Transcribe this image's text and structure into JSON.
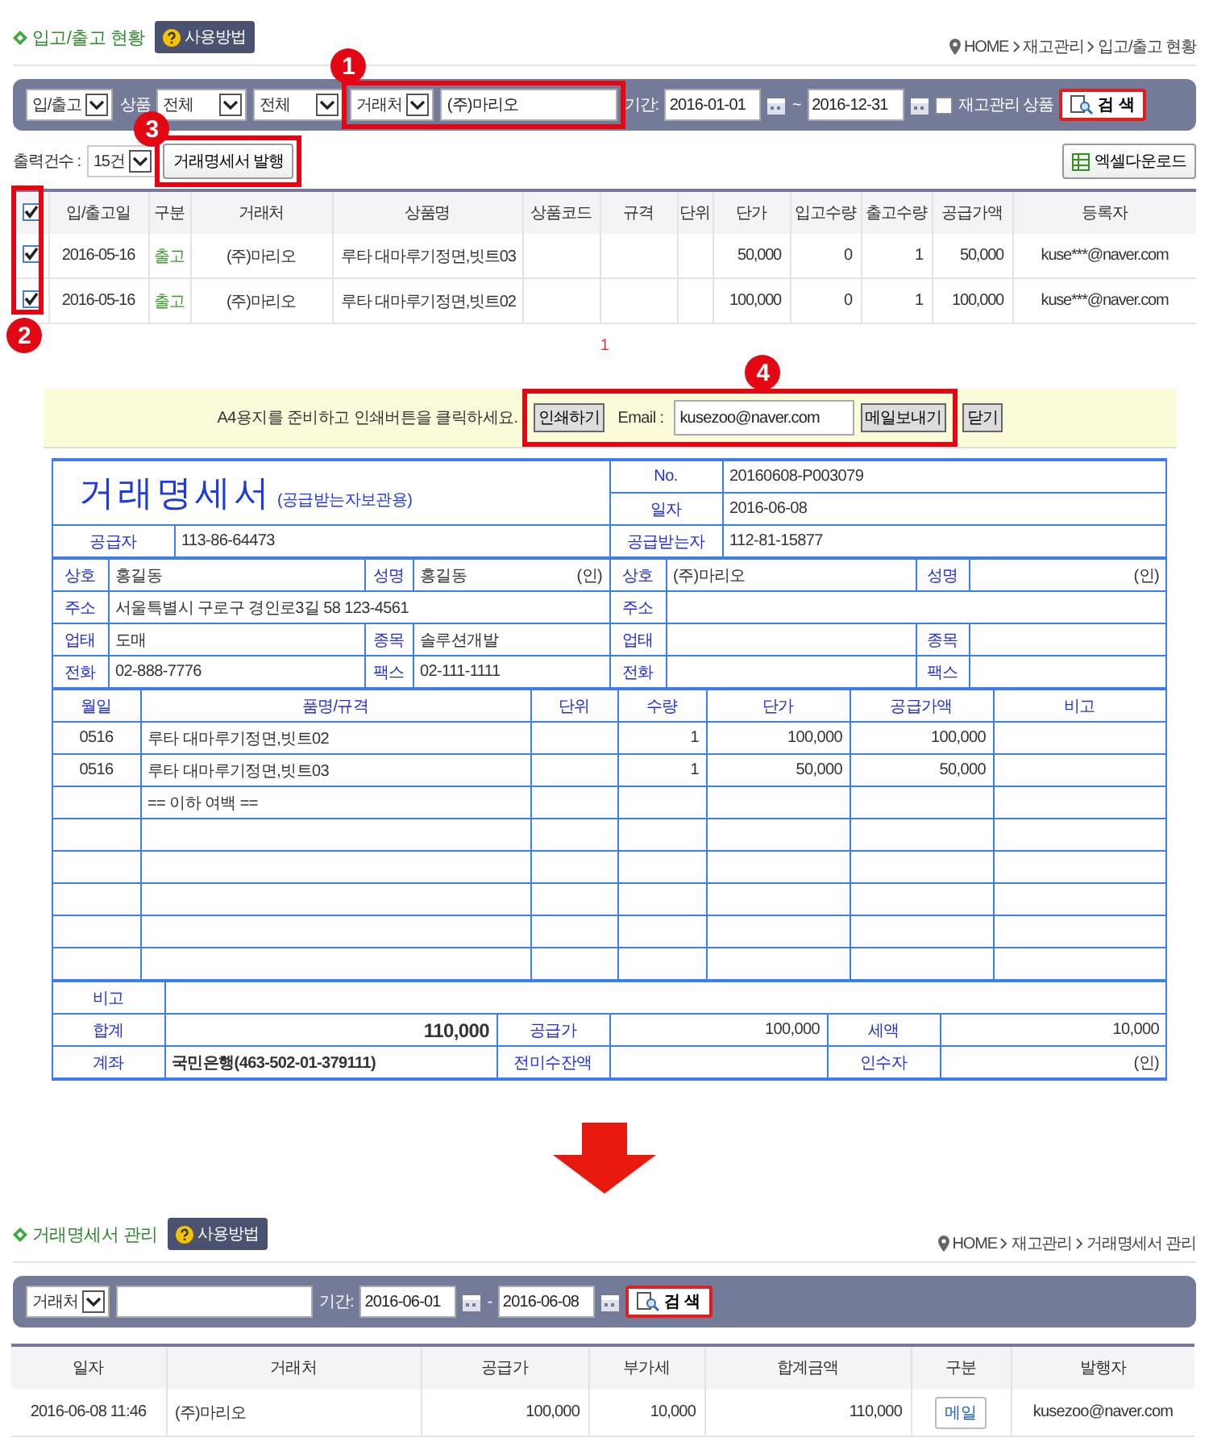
{
  "stock_page": {
    "title": "입고/출고 현황",
    "help_button": "사용방법",
    "breadcrumb": [
      "HOME",
      "재고관리",
      "입고/출고 현황"
    ],
    "filters": {
      "type_select": "입/출고",
      "product_label": "상품",
      "select_1": "전체",
      "select_2": "전체",
      "partner_select": "거래처",
      "partner_value": "(주)마리오",
      "partner_callout": "1",
      "period_label": "기간:",
      "date_from": "2016-01-01",
      "range_sep": "~",
      "date_to": "2016-12-31",
      "stock_only": {
        "label": "재고관리 상품",
        "checked": false
      },
      "search_button": "검 색"
    },
    "page_size_label": "출력건수 :",
    "page_size": "15건",
    "issue_button": "거래명세서 발행",
    "issue_callout": "3",
    "excel_button": "엑셀다운로드",
    "table": {
      "all_checked": true,
      "check_callout": "2",
      "columns": [
        "입/출고일",
        "구분",
        "거래처",
        "상품명",
        "상품코드",
        "규격",
        "단위",
        "단가",
        "입고수량",
        "출고수량",
        "공급가액",
        "등록자"
      ],
      "rows": [
        {
          "checked": true,
          "date": "2016-05-16",
          "kind": "출고",
          "partner": "(주)마리오",
          "product": "루타 대마루기정면,빗트03",
          "price": "50,000",
          "in_qty": "0",
          "out_qty": "1",
          "amount": "50,000",
          "user": "kuse***@naver.com"
        },
        {
          "checked": true,
          "date": "2016-05-16",
          "kind": "출고",
          "partner": "(주)마리오",
          "product": "루타 대마루기정면,빗트02",
          "price": "100,000",
          "in_qty": "0",
          "out_qty": "1",
          "amount": "100,000",
          "user": "kuse***@naver.com"
        }
      ]
    },
    "pages": [
      {
        "label": "1",
        "selected": true
      }
    ]
  },
  "print_bar": {
    "message": "A4용지를 준비하고 인쇄버튼을 클릭하세요.",
    "print_button": "인쇄하기",
    "email_label": "Email :",
    "email": "kusezoo@naver.com",
    "send_button": "메일보내기",
    "close_button": "닫기",
    "callout": "4"
  },
  "invoice": {
    "title": "거래명세서",
    "subtitle": "(공급받는자보관용)",
    "no_label": "No.",
    "no": "20160608-P003079",
    "date_label": "일자",
    "date": "2016-06-08",
    "supplier_label": "공급자",
    "supplier_reg": "113-86-64473",
    "receiver_label": "공급받는자",
    "receiver_reg": "112-81-15877",
    "party_rows": [
      {
        "left": [
          {
            "label": "상호",
            "value": "홍길동"
          },
          {
            "label": "성명",
            "value": "홍길동",
            "seal": "(인)"
          }
        ],
        "right": [
          {
            "label": "상호",
            "value": "(주)마리오"
          },
          {
            "label": "성명",
            "seal": "(인)"
          }
        ]
      },
      {
        "left": [
          {
            "label": "주소",
            "value": "서울특별시 구로구 경인로3길 58 123-4561"
          }
        ],
        "right": [
          {
            "label": "주소"
          }
        ]
      },
      {
        "left": [
          {
            "label": "업태",
            "value": "도매"
          },
          {
            "label": "종목",
            "value": "솔루션개발"
          }
        ],
        "right": [
          {
            "label": "업태"
          },
          {
            "label": "종목"
          }
        ]
      },
      {
        "left": [
          {
            "label": "전화",
            "value": "02-888-7776"
          },
          {
            "label": "팩스",
            "value": "02-111-1111"
          }
        ],
        "right": [
          {
            "label": "전화"
          },
          {
            "label": "팩스"
          }
        ]
      }
    ],
    "item_columns": [
      "월일",
      "품명/규격",
      "단위",
      "수량",
      "단가",
      "공급가액",
      "비고"
    ],
    "items": [
      {
        "date": "0516",
        "name": "루타 대마루기정면,빗트02",
        "qty": "1",
        "price": "100,000",
        "amount": "100,000"
      },
      {
        "date": "0516",
        "name": "루타 대마루기정면,빗트03",
        "qty": "1",
        "price": "50,000",
        "amount": "50,000"
      },
      {
        "name": "== 이하 여백 =="
      }
    ],
    "note_label": "비고",
    "total_label": "합계",
    "total": "110,000",
    "supply_label": "공급가",
    "supply": "100,000",
    "tax_label": "세액",
    "tax": "10,000",
    "account_label": "계좌",
    "account": "국민은행(463-502-01-379111)",
    "balance_label": "전미수잔액",
    "recipient_label": "인수자",
    "recipient_seal": "(인)"
  },
  "invoice_page": {
    "title": "거래명세서 관리",
    "help_button": "사용방법",
    "breadcrumb": [
      "HOME",
      "재고관리",
      "거래명세서 관리"
    ],
    "filters": {
      "partner_select": "거래처",
      "period_label": "기간:",
      "date_from": "2016-06-01",
      "range_sep": "-",
      "date_to": "2016-06-08",
      "search_button": "검 색"
    },
    "table": {
      "columns": [
        "일자",
        "거래처",
        "공급가",
        "부가세",
        "합계금액",
        "구분",
        "발행자"
      ],
      "rows": [
        {
          "date": "2016-06-08 11:46",
          "partner": "(주)마리오",
          "supply": "100,000",
          "tax": "10,000",
          "total": "110,000",
          "kind_button": "메일",
          "issuer": "kusezoo@naver.com"
        }
      ]
    }
  }
}
